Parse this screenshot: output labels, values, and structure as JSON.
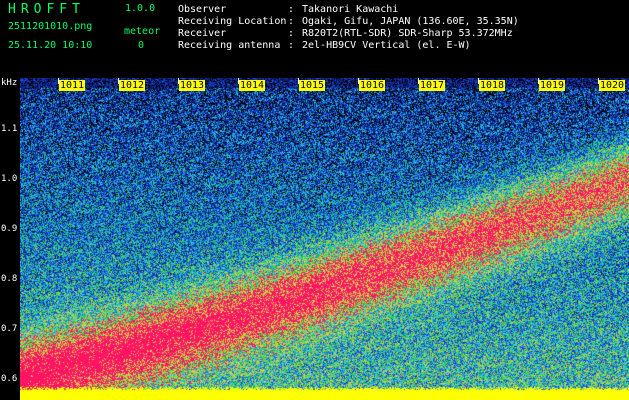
{
  "header": {
    "app_title": "HROFFT",
    "app_version": "1.0.0",
    "file_name": "2511201010.png",
    "date_time": "25.11.20 10:10",
    "meteor_label": "meteor",
    "meteor_count": "0"
  },
  "info": {
    "rows": [
      {
        "key": "Observer",
        "value": "Takanori Kawachi"
      },
      {
        "key": "Receiving Location",
        "value": "Ogaki, Gifu, JAPAN (136.60E, 35.35N)"
      },
      {
        "key": "Receiver",
        "value": "R820T2(RTL-SDR) SDR-Sharp 53.372MHz"
      },
      {
        "key": "Receiving antenna",
        "value": "2el-HB9CV Vertical (el. E-W)"
      }
    ],
    "separator": ":"
  },
  "axis": {
    "unit": "kHz",
    "y_labels": [
      "1.1",
      "1.0",
      "0.9",
      "0.8",
      "0.7",
      "0.6"
    ],
    "time_ticks": [
      "1011",
      "1012",
      "1013",
      "1014",
      "1015",
      "1016",
      "1017",
      "1018",
      "1019",
      "1020"
    ]
  },
  "colors": {
    "background": "#000000",
    "title_green": "#00ff66",
    "info_white": "#ffffff",
    "tick_yellow": "#ffff00",
    "low_band_yellow": "#ffff00",
    "signal_red": "#ff1060",
    "noise_blue": "#1040c0",
    "noise_green": "#20c040",
    "noise_cyan": "#40d0e0"
  }
}
